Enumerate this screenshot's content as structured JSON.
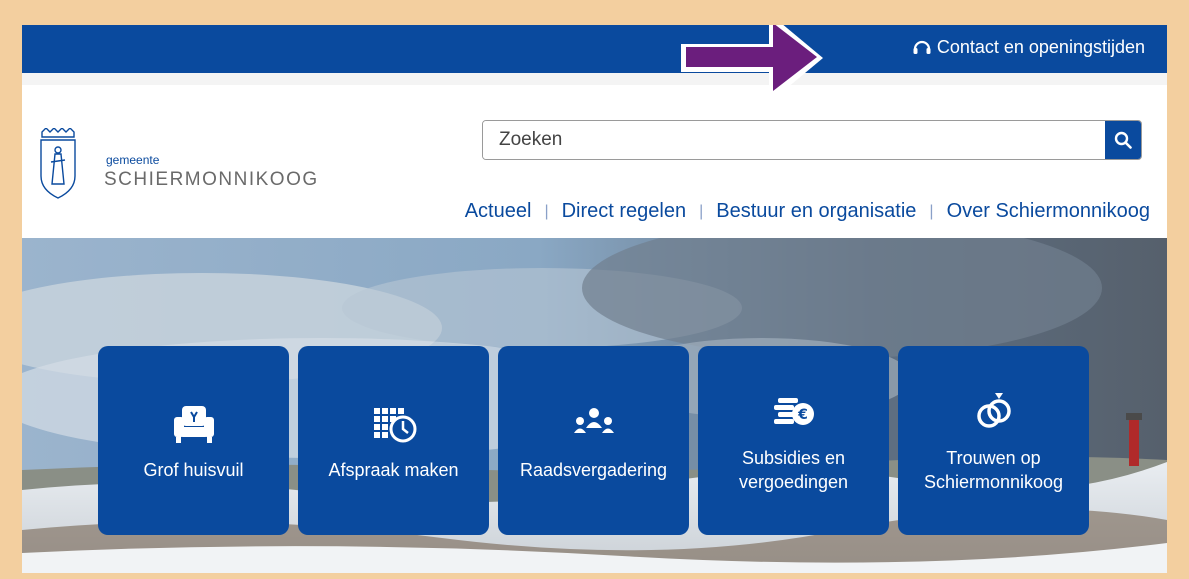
{
  "topbar": {
    "contact_label": "Contact en openingstijden"
  },
  "logo": {
    "gemeente": "gemeente",
    "name": "SCHIERMONNIKOOG"
  },
  "search": {
    "placeholder": "Zoeken"
  },
  "nav": {
    "items": [
      "Actueel",
      "Direct regelen",
      "Bestuur en organisatie",
      "Over Schiermonnikoog"
    ]
  },
  "tiles": [
    {
      "label": "Grof huisvuil",
      "icon": "armchair-icon"
    },
    {
      "label": "Afspraak maken",
      "icon": "calendar-clock-icon"
    },
    {
      "label": "Raadsvergadering",
      "icon": "meeting-icon"
    },
    {
      "label": "Subsidies en vergoedingen",
      "icon": "coins-euro-icon"
    },
    {
      "label": "Trouwen op Schiermonnikoog",
      "icon": "wedding-rings-icon"
    }
  ],
  "colors": {
    "brand": "#0a4a9e",
    "frame": "#f3cf9f",
    "arrow": "#6b1e7d"
  }
}
